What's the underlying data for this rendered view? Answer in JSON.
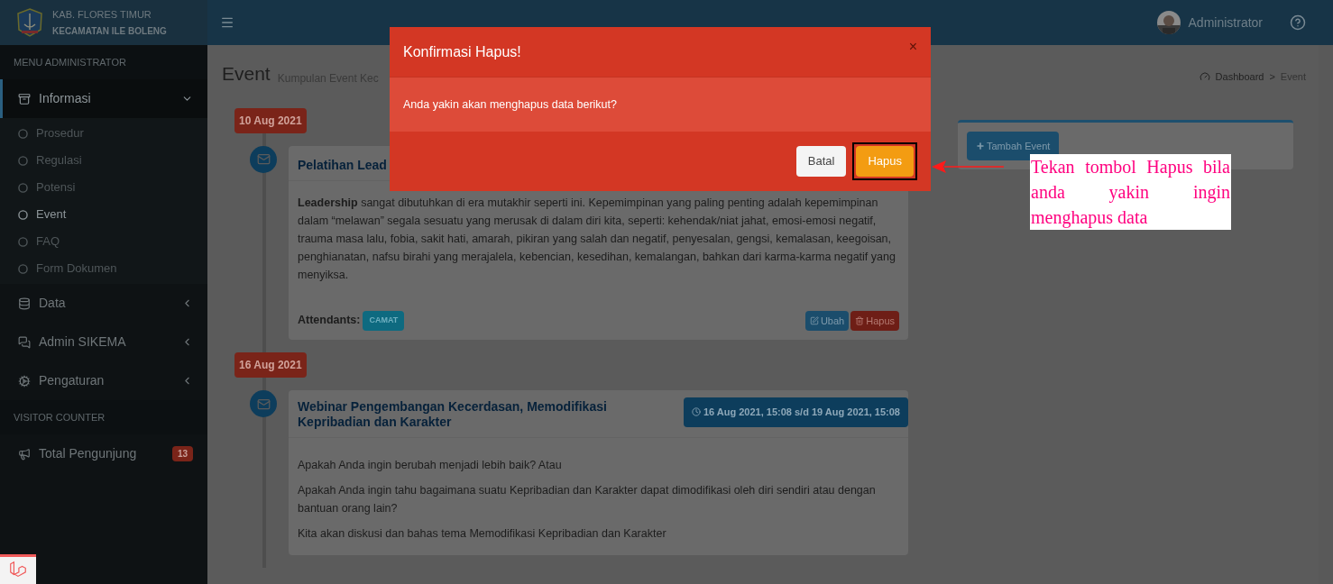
{
  "brand": {
    "line1": "KAB. FLORES TIMUR",
    "line2": "KECAMATAN ILE BOLENG"
  },
  "sidebar": {
    "sections": [
      {
        "header": "MENU ADMINISTRATOR",
        "items": [
          {
            "label": "Informasi",
            "kind": "archive",
            "expanded": true,
            "selected": true,
            "children": [
              {
                "label": "Prosedur",
                "selected": false
              },
              {
                "label": "Regulasi",
                "selected": false
              },
              {
                "label": "Potensi",
                "selected": false
              },
              {
                "label": "Event",
                "selected": true
              },
              {
                "label": "FAQ",
                "selected": false
              },
              {
                "label": "Form Dokumen",
                "selected": false
              }
            ]
          },
          {
            "label": "Data",
            "kind": "database",
            "expanded": false,
            "selected": false
          },
          {
            "label": "Admin SIKEMA",
            "kind": "comments",
            "expanded": false,
            "selected": false
          },
          {
            "label": "Pengaturan",
            "kind": "cogs",
            "expanded": false,
            "selected": false
          }
        ]
      },
      {
        "header": "VISITOR COUNTER",
        "items": [
          {
            "label": "Total Pengunjung",
            "kind": "bullhorn",
            "badge": "13",
            "selected": false
          }
        ]
      }
    ]
  },
  "topbar": {
    "user": "Administrator"
  },
  "page": {
    "title": "Event",
    "subtitle": "Kumpulan Event Kec",
    "breadcrumb": [
      "Dashboard",
      "Event"
    ],
    "breadcrumb_separator": ">"
  },
  "timeline": [
    {
      "date": "10 Aug 2021",
      "event": {
        "title": "Pelatihan Lead",
        "paragraphs": [
          "**Leadership** sangat dibutuhkan di era mutakhir seperti ini. Kepemimpinan yang paling penting adalah kepemimpinan dalam “melawan” segala sesuatu yang merusak di dalam diri kita, seperti: kehendak/niat jahat, emosi-emosi negatif, trauma masa lalu, fobia, sakit hati, amarah, pikiran yang salah dan negatif, penyesalan, gengsi, kemalasan, keegoisan, penghianatan, nafsu birahi yang merajalela, kebencian, kesedihan, kemalangan, bahkan dari karma-karma negatif yang menyiksa."
        ],
        "attendants_label": "Attendants:",
        "attendants": [
          "CAMAT"
        ],
        "actions": [
          {
            "label": "Ubah",
            "kind": "edit"
          },
          {
            "label": "Hapus",
            "kind": "delete"
          }
        ]
      }
    },
    {
      "date": "16 Aug 2021",
      "event": {
        "title": "Webinar Pengembangan Kecerdasan, Memodifikasi Kepribadian dan Karakter",
        "period": "16 Aug 2021, 15:08 s/d 19 Aug 2021, 15:08",
        "paragraphs": [
          "Apakah Anda ingin berubah menjadi lebih baik? Atau",
          "Apakah Anda ingin tahu bagaimana suatu Kepribadian dan Karakter dapat dimodifikasi oleh diri sendiri atau dengan bantuan orang lain?",
          "Kita akan diskusi dan bahas tema Memodifikasi Kepribadian dan Karakter"
        ]
      }
    }
  ],
  "side_panel": {
    "button": "Tambah Event"
  },
  "modal": {
    "title": "Konfirmasi Hapus!",
    "close": "×",
    "message": "Anda yakin akan menghapus data berikut?",
    "buttons": [
      {
        "label": "Batal",
        "kind": "default",
        "highlighted": false
      },
      {
        "label": "Hapus",
        "kind": "warning",
        "highlighted": true
      }
    ]
  },
  "annotation": {
    "text": "Tekan tombol Hapus bila anda yakin ingin menghapus data"
  }
}
